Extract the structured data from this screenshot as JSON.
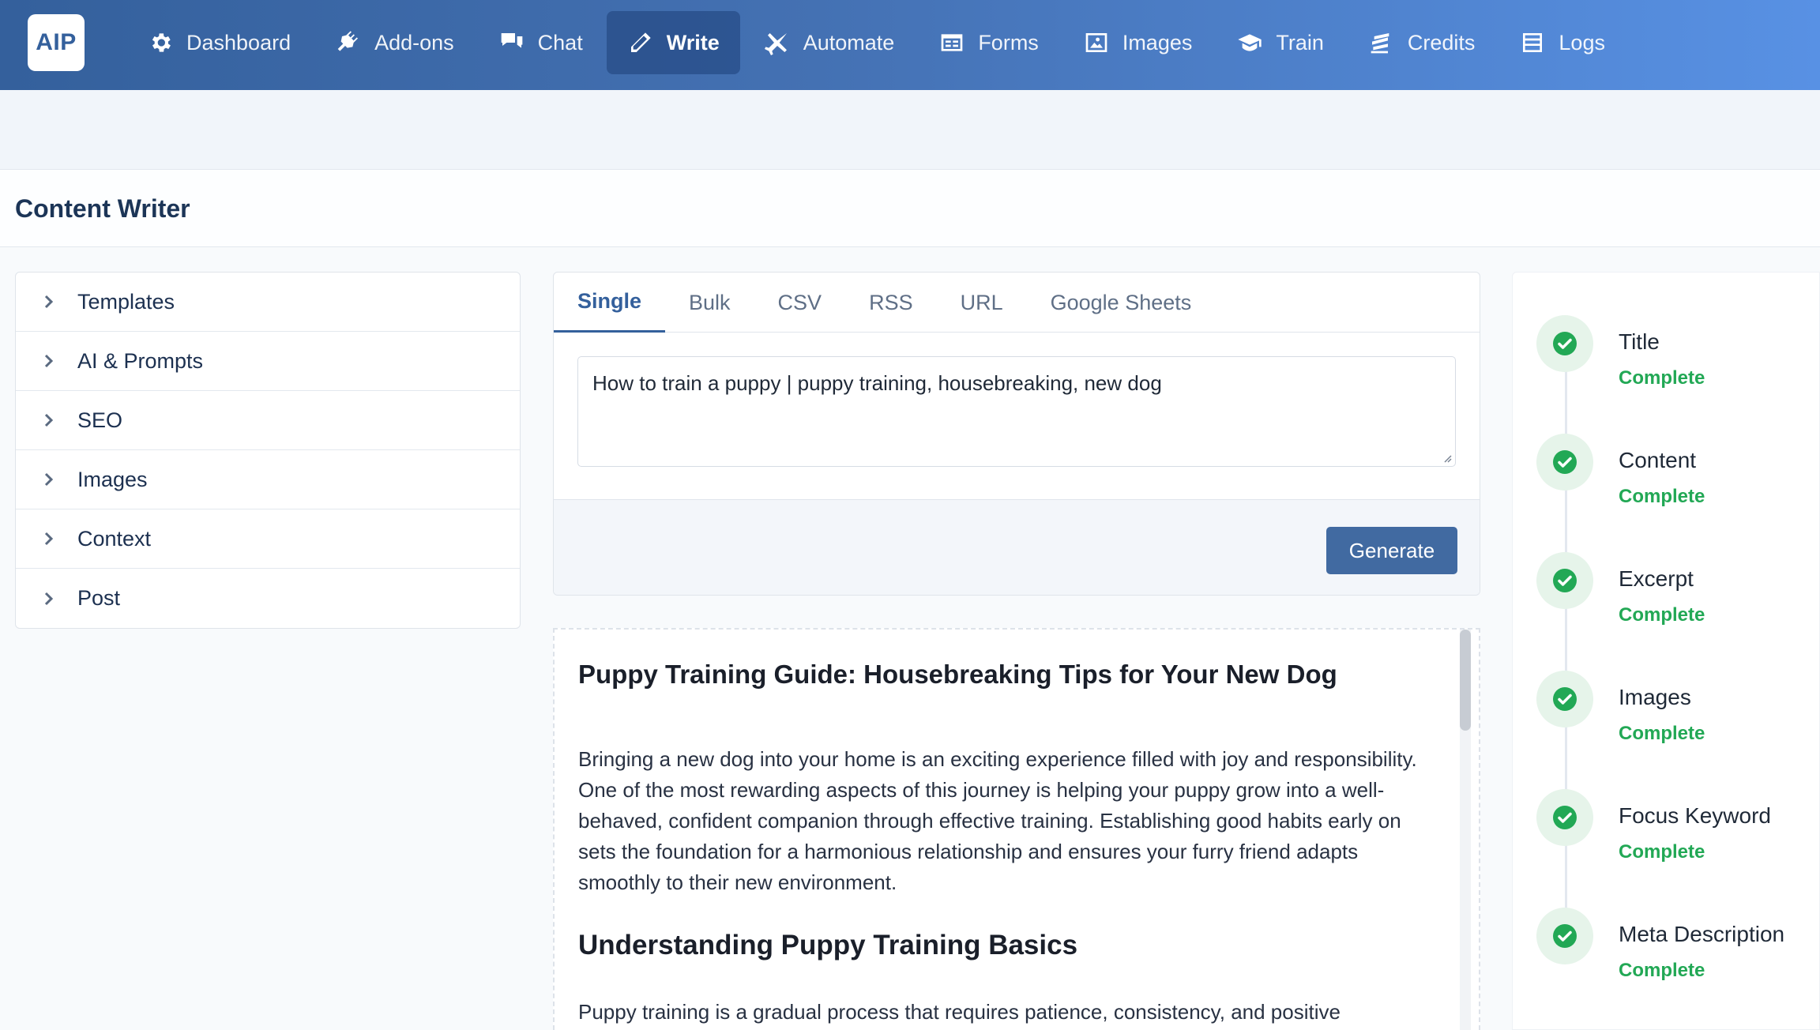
{
  "app": {
    "logo_text": "AIP"
  },
  "colors": {
    "accent": "#34609c",
    "success": "#22a855",
    "nav_gradient_end": "#5891e4"
  },
  "nav": [
    {
      "label": "Dashboard",
      "icon": "gear-icon"
    },
    {
      "label": "Add-ons",
      "icon": "plug-icon"
    },
    {
      "label": "Chat",
      "icon": "chat-icon"
    },
    {
      "label": "Write",
      "icon": "pencil-icon",
      "active": true
    },
    {
      "label": "Automate",
      "icon": "plane-icon"
    },
    {
      "label": "Forms",
      "icon": "form-icon"
    },
    {
      "label": "Images",
      "icon": "image-icon"
    },
    {
      "label": "Train",
      "icon": "graduation-cap-icon"
    },
    {
      "label": "Credits",
      "icon": "coins-icon"
    },
    {
      "label": "Logs",
      "icon": "list-icon"
    }
  ],
  "page": {
    "title": "Content Writer"
  },
  "sidebar": {
    "items": [
      {
        "label": "Templates"
      },
      {
        "label": "AI & Prompts"
      },
      {
        "label": "SEO"
      },
      {
        "label": "Images"
      },
      {
        "label": "Context"
      },
      {
        "label": "Post"
      }
    ]
  },
  "writer": {
    "tabs": [
      {
        "label": "Single",
        "active": true
      },
      {
        "label": "Bulk"
      },
      {
        "label": "CSV"
      },
      {
        "label": "RSS"
      },
      {
        "label": "URL"
      },
      {
        "label": "Google Sheets"
      }
    ],
    "input_value": "How to train a puppy | puppy training, housebreaking, new dog",
    "generate_label": "Generate"
  },
  "article": {
    "title": "Puppy Training Guide: Housebreaking Tips for Your New Dog",
    "intro": "Bringing a new dog into your home is an exciting experience filled with joy and responsibility. One of the most rewarding aspects of this journey is helping your puppy grow into a well-behaved, confident companion through effective training. Establishing good habits early on sets the foundation for a harmonious relationship and ensures your furry friend adapts smoothly to their new environment.",
    "heading": "Understanding Puppy Training Basics",
    "para2": "Puppy training is a gradual process that requires patience, consistency, and positive"
  },
  "progress": {
    "steps": [
      {
        "label": "Title",
        "status": "Complete"
      },
      {
        "label": "Content",
        "status": "Complete"
      },
      {
        "label": "Excerpt",
        "status": "Complete"
      },
      {
        "label": "Images",
        "status": "Complete"
      },
      {
        "label": "Focus Keyword",
        "status": "Complete"
      },
      {
        "label": "Meta Description",
        "status": "Complete"
      }
    ]
  }
}
